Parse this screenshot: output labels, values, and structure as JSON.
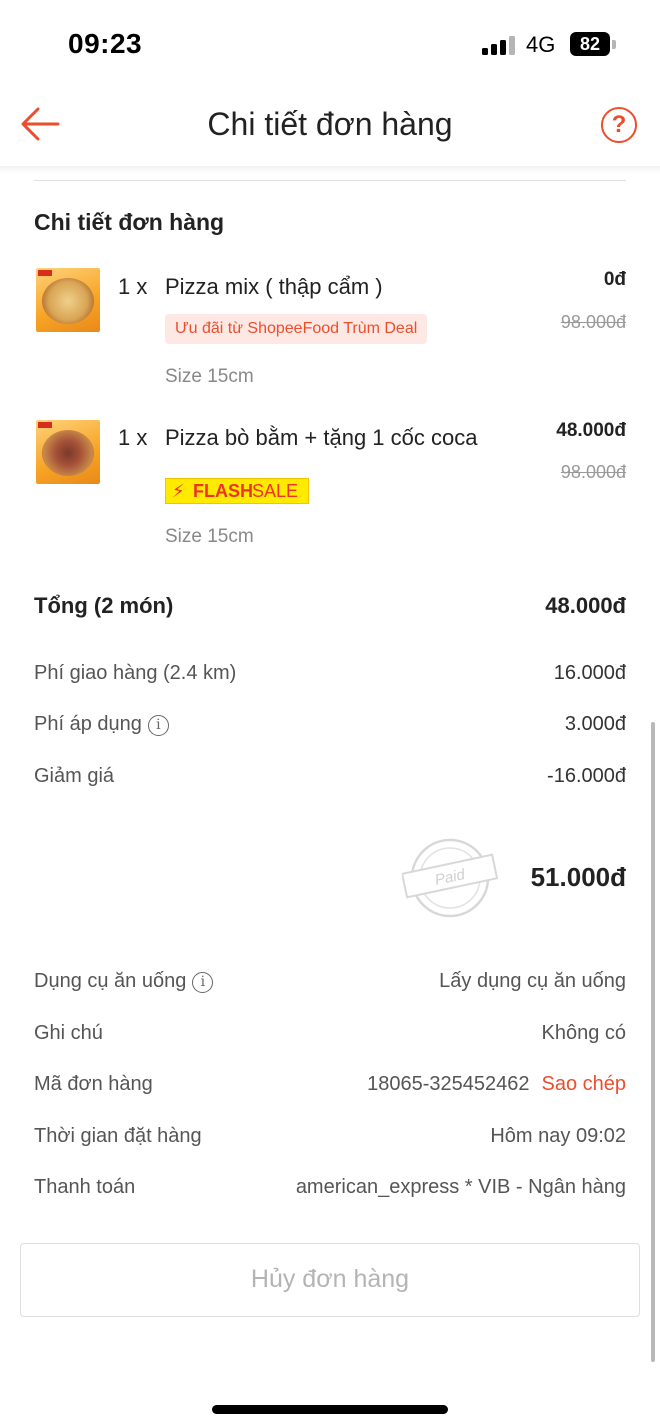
{
  "status_bar": {
    "time": "09:23",
    "network": "4G",
    "battery": "82"
  },
  "header": {
    "title": "Chi tiết đơn hàng",
    "back_icon": "arrow-left-icon",
    "help_icon": "question-circle-icon",
    "help_symbol": "?"
  },
  "section": {
    "title": "Chi tiết đơn hàng"
  },
  "items": [
    {
      "qty": "1 x",
      "name": "Pizza mix ( thập cẩm )",
      "price": "0đ",
      "old_price": "98.000đ",
      "promo": "Ưu đãi từ ShopeeFood Trùm Deal",
      "note": "Size 15cm"
    },
    {
      "qty": "1 x",
      "name": "Pizza bò bằm + tặng 1 cốc coca",
      "price": "48.000đ",
      "old_price": "98.000đ",
      "flash_bolt": "⚡",
      "flash_label_1": "FLASH",
      "flash_label_2": "SALE",
      "note": "Size 15cm"
    }
  ],
  "summary": {
    "total_label": "Tổng (2 món)",
    "total_value": "48.000đ",
    "shipping_label": "Phí giao hàng (2.4 km)",
    "shipping_value": "16.000đ",
    "fee_label": "Phí áp dụng",
    "fee_value": "3.000đ",
    "discount_label": "Giảm giá",
    "discount_value": "-16.000đ",
    "paid_stamp": "Paid",
    "grand_total": "51.000đ",
    "info_symbol": "i"
  },
  "info": {
    "utensils_label": "Dụng cụ ăn uống",
    "utensils_value": "Lấy dụng cụ ăn uống",
    "note_label": "Ghi chú",
    "note_value": "Không có",
    "order_id_label": "Mã đơn hàng",
    "order_id_value": "18065-325452462",
    "copy_label": "Sao chép",
    "order_time_label": "Thời gian đặt hàng",
    "order_time_value": "Hôm nay 09:02",
    "payment_label": "Thanh toán",
    "payment_value": "american_express * VIB - Ngân hàng"
  },
  "actions": {
    "cancel_label": "Hủy đơn hàng"
  },
  "colors": {
    "accent": "#ee4d2d",
    "flash_bg": "#ffea00",
    "promo_bg": "#fde8e4",
    "muted": "#b4b4b4"
  }
}
